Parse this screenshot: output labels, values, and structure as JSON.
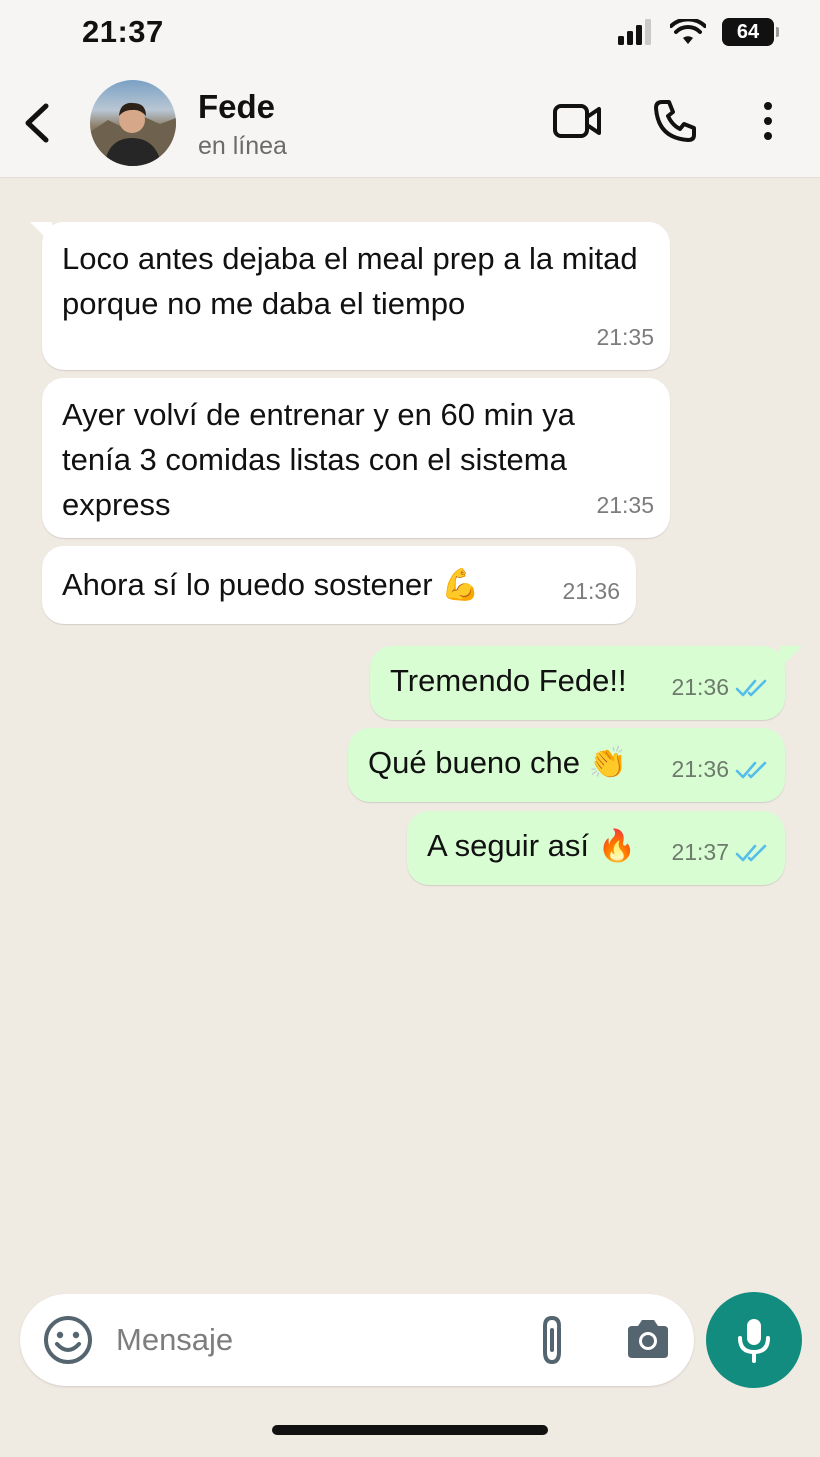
{
  "status_bar": {
    "time": "21:37",
    "battery": "64"
  },
  "header": {
    "contact_name": "Fede",
    "contact_status": "en línea"
  },
  "messages": [
    {
      "direction": "in",
      "text": "Loco antes dejaba el meal prep a la mitad porque no me daba el tiempo",
      "time": "21:35"
    },
    {
      "direction": "in",
      "text": "Ayer volví de entrenar y en 60 min ya tenía 3 comidas listas con el sistema express",
      "time": "21:35"
    },
    {
      "direction": "in",
      "text": "Ahora sí lo puedo sostener 💪",
      "time": "21:36"
    },
    {
      "direction": "out",
      "text": "Tremendo Fede!!",
      "time": "21:36",
      "status": "read"
    },
    {
      "direction": "out",
      "text": "Qué bueno che 👏",
      "time": "21:36",
      "status": "read"
    },
    {
      "direction": "out",
      "text": "A seguir así 🔥",
      "time": "21:37",
      "status": "read"
    }
  ],
  "composer": {
    "placeholder": "Mensaje"
  },
  "icons": {
    "back": "chevron-left-icon",
    "video": "video-camera-icon",
    "call": "phone-icon",
    "menu": "more-vertical-icon",
    "emoji": "emoji-icon",
    "attach": "paperclip-icon",
    "camera": "camera-icon",
    "mic": "microphone-icon",
    "read_receipt": "double-check-icon"
  },
  "colors": {
    "background": "#efeae2",
    "incoming_bubble": "#ffffff",
    "outgoing_bubble": "#d9fdd3",
    "read_receipt": "#53bdeb",
    "mic_button": "#128c7e"
  }
}
